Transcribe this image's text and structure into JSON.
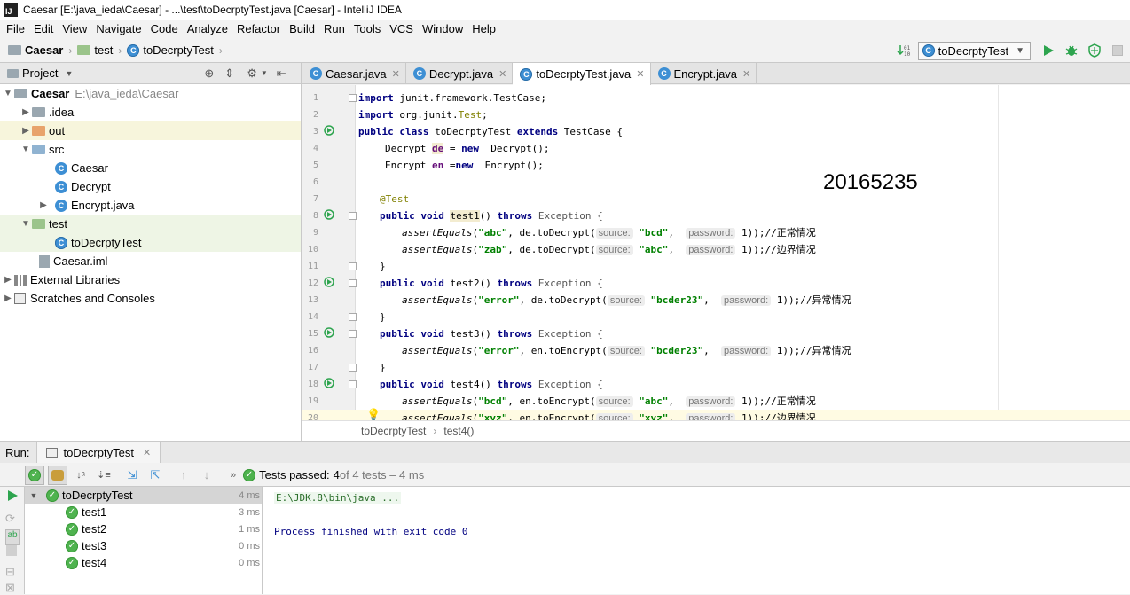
{
  "window": {
    "title": "Caesar [E:\\java_ieda\\Caesar] - ...\\test\\toDecrptyTest.java [Caesar] - IntelliJ IDEA",
    "app_icon": "IJ"
  },
  "menu": [
    "File",
    "Edit",
    "View",
    "Navigate",
    "Code",
    "Analyze",
    "Refactor",
    "Build",
    "Run",
    "Tools",
    "VCS",
    "Window",
    "Help"
  ],
  "nav": {
    "project": "Caesar",
    "folder": "test",
    "file": "toDecrptyTest",
    "run_config": "toDecrptyTest"
  },
  "project_panel": {
    "title": "Project",
    "tree": [
      {
        "label": "Caesar",
        "extra": "E:\\java_ieda\\Caesar",
        "depth": 0,
        "icon": "module-folder-icon",
        "arrow": "down"
      },
      {
        "label": ".idea",
        "depth": 1,
        "icon": "folder-icon",
        "arrow": "right"
      },
      {
        "label": "out",
        "depth": 1,
        "icon": "out-folder-icon",
        "arrow": "right"
      },
      {
        "label": "src",
        "depth": 1,
        "icon": "source-folder-icon",
        "arrow": "down"
      },
      {
        "label": "Caesar",
        "depth": 2,
        "icon": "class-icon",
        "arrow": ""
      },
      {
        "label": "Decrypt",
        "depth": 2,
        "icon": "class-icon",
        "arrow": ""
      },
      {
        "label": "Encrypt.java",
        "depth": 2,
        "icon": "class-icon",
        "arrow": "right"
      },
      {
        "label": "test",
        "depth": 1,
        "icon": "test-folder-icon",
        "arrow": "down"
      },
      {
        "label": "toDecrptyTest",
        "depth": 2,
        "icon": "test-class-icon",
        "arrow": ""
      },
      {
        "label": "Caesar.iml",
        "depth": 1,
        "icon": "iml-file-icon",
        "arrow": ""
      },
      {
        "label": "External Libraries",
        "depth": 0,
        "icon": "libraries-icon",
        "arrow": "right"
      },
      {
        "label": "Scratches and Consoles",
        "depth": 0,
        "icon": "scratches-icon",
        "arrow": "right"
      }
    ]
  },
  "editor_tabs": [
    {
      "label": "Caesar.java",
      "active": false
    },
    {
      "label": "Decrypt.java",
      "active": false
    },
    {
      "label": "toDecrptyTest.java",
      "active": true
    },
    {
      "label": "Encrypt.java",
      "active": false
    }
  ],
  "code": {
    "line_numbers": [
      "1",
      "2",
      "3",
      "4",
      "5",
      "6",
      "7",
      "8",
      "9",
      "10",
      "11",
      "12",
      "13",
      "14",
      "15",
      "16",
      "17",
      "18",
      "19",
      "20"
    ],
    "l1a": "import",
    "l1b": " junit.framework.TestCase;",
    "l2a": "import",
    "l2b": " org.junit.",
    "l2c": "Test",
    "l2d": ";",
    "l3a": "public class",
    "l3b": " toDecrptyTest ",
    "l3c": "extends",
    "l3d": " TestCase {",
    "l4a": "Decrypt ",
    "l4b": "de",
    "l4c": " = ",
    "l4d": "new",
    "l4e": "  Decrypt();",
    "l5a": "Encrypt ",
    "l5b": "en",
    "l5c": " =",
    "l5d": "new",
    "l5e": "  Encrypt();",
    "l7": "@Test",
    "public_void": "public void",
    "throws": "throws",
    "exception": " Exception {",
    "test1": "test1",
    "test2": "test2",
    "test3": "test3",
    "test4": "test4",
    "parens": "() ",
    "assert": "assertEquals",
    "open": "(",
    "de_dec": ", de.toDecrypt(",
    "en_enc": ", en.toEncrypt(",
    "source": "source:",
    "password": "password:",
    "pw_tail1": " 1));//正常情况",
    "pw_tail2": " 1));//边界情况",
    "pw_tail3": " 1));//异常情况",
    "s_abc": "\"abc\"",
    "s_bcd": "\"bcd\"",
    "s_zab": "\"zab\"",
    "s_error": "\"error\"",
    "s_bcder23": "\"bcder23\"",
    "s_xyz": "\"xyz\"",
    "comma": ",  ",
    "close_brace": "}"
  },
  "overlay_number": "20165235",
  "editor_breadcrumb": {
    "cls": "toDecrptyTest",
    "method": "test4()"
  },
  "run": {
    "label": "Run:",
    "tab": "toDecrptyTest",
    "status_prefix": "Tests passed:",
    "passed": "4",
    "status_suffix": " of 4 tests – 4 ms",
    "tests": [
      {
        "name": "toDecrptyTest",
        "duration": "4 ms",
        "root": true
      },
      {
        "name": "test1",
        "duration": "3 ms",
        "root": false
      },
      {
        "name": "test2",
        "duration": "1 ms",
        "root": false
      },
      {
        "name": "test3",
        "duration": "0 ms",
        "root": false
      },
      {
        "name": "test4",
        "duration": "0 ms",
        "root": false
      }
    ],
    "console": [
      "E:\\JDK.8\\bin\\java ...",
      "Process finished with exit code 0"
    ]
  },
  "colors": {
    "keyword": "#000080",
    "string": "#008000",
    "pass": "#4fb34f",
    "run_green": "#2da44e"
  }
}
